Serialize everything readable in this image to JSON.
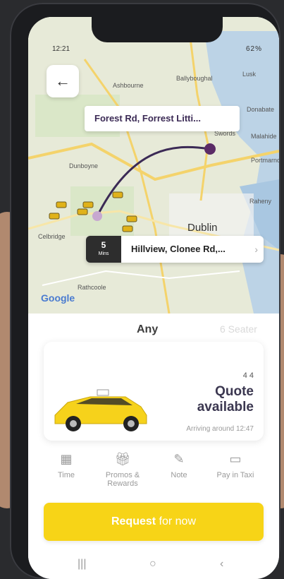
{
  "status": {
    "time": "12:21",
    "right": "62%"
  },
  "map": {
    "labels": [
      "Ashbourne",
      "Ballyboughal",
      "Lusk",
      "Donabate",
      "Swords",
      "Malahide",
      "Portmarnock",
      "Dunboyne",
      "Raheny",
      "Celbridge",
      "Dublin",
      "Rathcoole"
    ],
    "from_chip": "Forest Rd, Forrest Litti...",
    "to_chip": "Hillview, Clonee Rd,...",
    "eta_value": "5",
    "eta_unit": "Mins",
    "google": "Google",
    "accent": "#5b2b66"
  },
  "tabs": {
    "any": "Any",
    "seater": "6 Seater"
  },
  "card": {
    "capacity": "4  4",
    "quote_line1": "Quote",
    "quote_line2": "available",
    "arriving": "Arriving around 12:47"
  },
  "actions": [
    {
      "label": "Time"
    },
    {
      "label": "Promos & Rewards"
    },
    {
      "label": "Note"
    },
    {
      "label": "Pay in Taxi"
    }
  ],
  "request": {
    "strong": "Request",
    "rest": " for now",
    "color": "#f7d417"
  },
  "colors": {
    "brand": "#f7d417",
    "route": "#5b2b66"
  }
}
